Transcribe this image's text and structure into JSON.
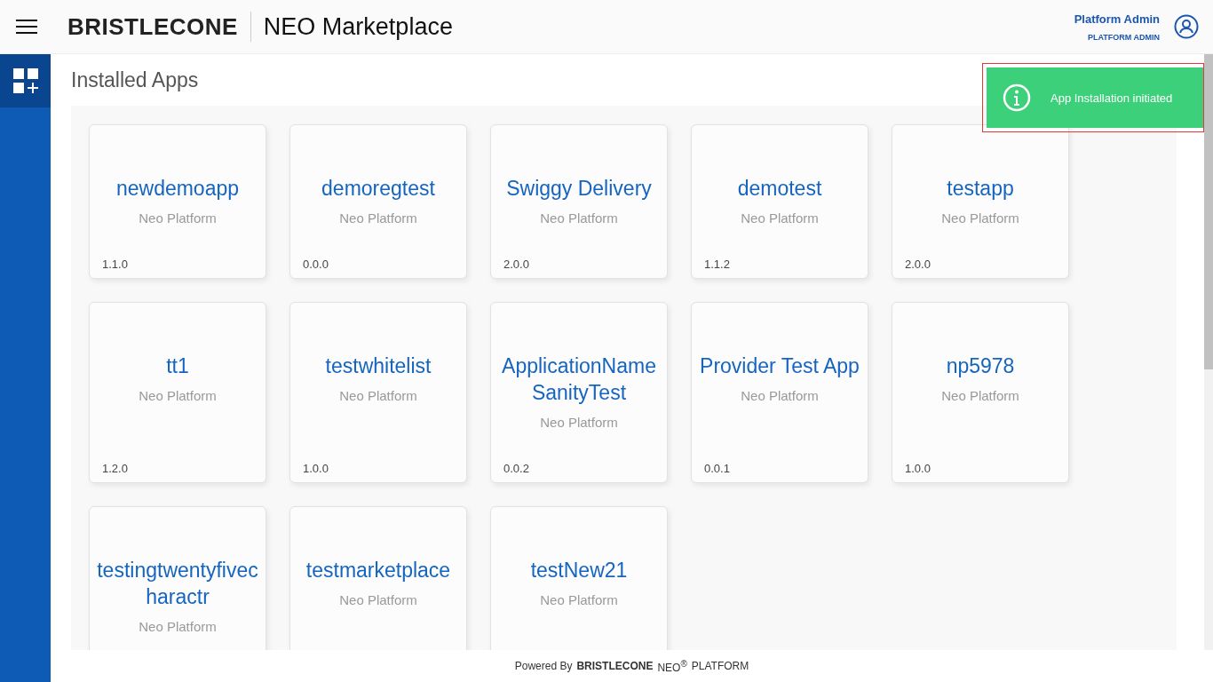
{
  "header": {
    "logo": "BRISTLECONE",
    "title": "NEO Marketplace",
    "user": {
      "name": "Platform Admin",
      "role": "PLATFORM ADMIN"
    }
  },
  "page": {
    "title": "Installed Apps"
  },
  "toast": {
    "message": "App Installation initiated"
  },
  "apps": [
    {
      "name": "newdemoapp",
      "provider": "Neo Platform",
      "version": "1.1.0"
    },
    {
      "name": "demoregtest",
      "provider": "Neo Platform",
      "version": "0.0.0"
    },
    {
      "name": "Swiggy Delivery",
      "provider": "Neo Platform",
      "version": "2.0.0"
    },
    {
      "name": "demotest",
      "provider": "Neo Platform",
      "version": "1.1.2"
    },
    {
      "name": "testapp",
      "provider": "Neo Platform",
      "version": "2.0.0"
    },
    {
      "name": "tt1",
      "provider": "Neo Platform",
      "version": "1.2.0"
    },
    {
      "name": "testwhitelist",
      "provider": "Neo Platform",
      "version": "1.0.0"
    },
    {
      "name": "ApplicationNameSanityTest",
      "provider": "Neo Platform",
      "version": "0.0.2"
    },
    {
      "name": "Provider Test App",
      "provider": "Neo Platform",
      "version": "0.0.1"
    },
    {
      "name": "np5978",
      "provider": "Neo Platform",
      "version": "1.0.0"
    },
    {
      "name": "testingtwentyfivecharactr",
      "provider": "Neo Platform"
    },
    {
      "name": "testmarketplace",
      "provider": "Neo Platform"
    },
    {
      "name": "testNew21",
      "provider": "Neo Platform"
    }
  ],
  "footer": {
    "prefix": "Powered By",
    "brand": "BRISTLECONE",
    "product": "NEO$^{®}$",
    "suffix": "PLATFORM"
  }
}
